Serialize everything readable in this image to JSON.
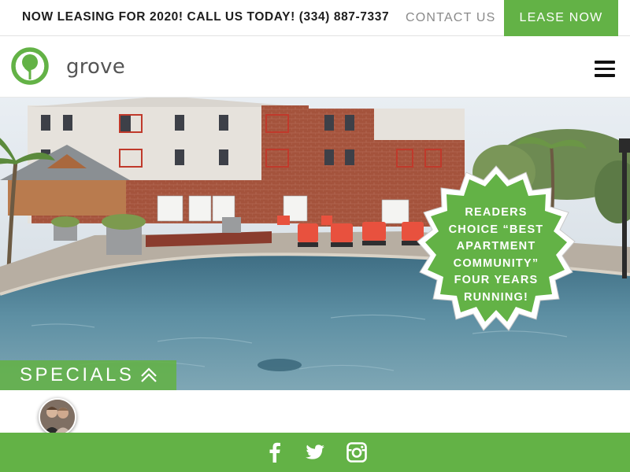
{
  "topbar": {
    "promo": "NOW LEASING FOR 2020! CALL US TODAY! (334) 887-7337",
    "contact_label": "CONTACT US",
    "lease_label": "LEASE NOW"
  },
  "header": {
    "logo_text": "grove",
    "menu_icon": "hamburger-menu-icon"
  },
  "hero": {
    "badge_text": "READERS CHOICE “BEST APARTMENT COMMUNITY” FOUR YEARS RUNNING!"
  },
  "specials": {
    "label": "SPECIALS",
    "icon": "double-chevron-up-icon"
  },
  "footer": {
    "social": [
      "facebook-icon",
      "twitter-icon",
      "instagram-icon"
    ]
  },
  "colors": {
    "brand_green": "#63b246",
    "text_dark": "#1d1d1d",
    "text_muted": "#8a8a8a"
  }
}
